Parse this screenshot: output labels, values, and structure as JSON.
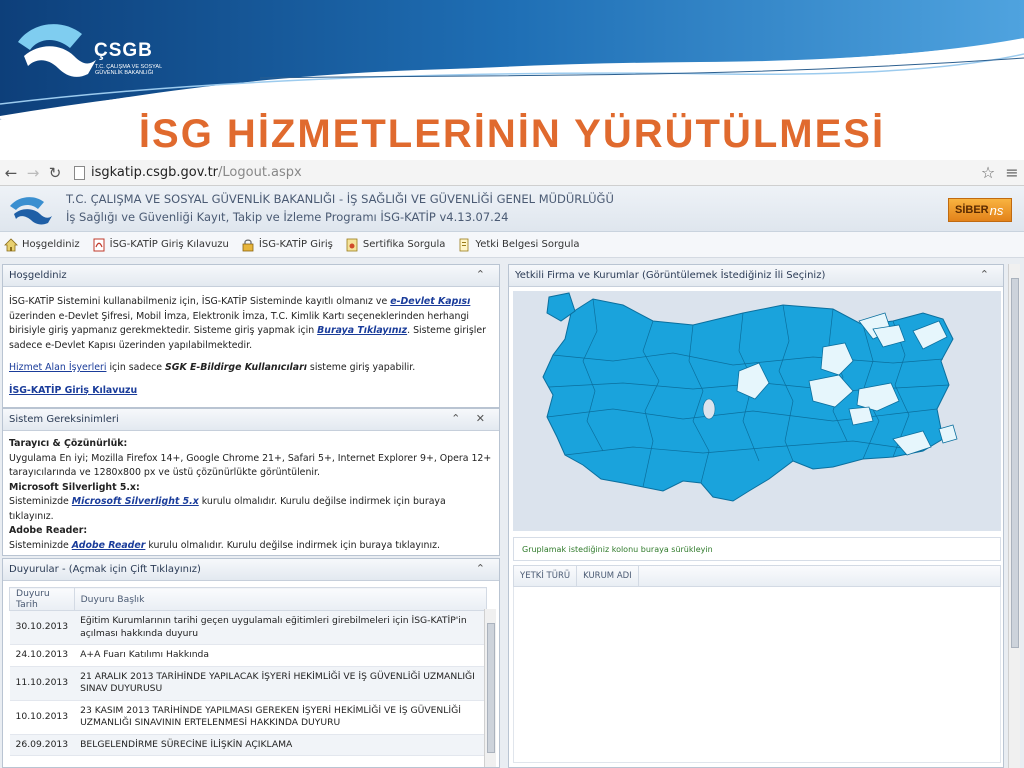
{
  "slide": {
    "logo_text": "ÇSGB",
    "logo_subtitle": "T.C. ÇALIŞMA VE SOSYAL GÜVENLİK BAKANLIĞI",
    "title": "İSG HİZMETLERİNİN YÜRÜTÜLMESİ",
    "colors": {
      "title": "#e06a2e",
      "banner": "#1a5a9e"
    }
  },
  "browser": {
    "url_host": "isgkatip.csgb.gov.tr",
    "url_path": "/Logout.aspx",
    "icons": [
      "back-arrow-icon",
      "forward-arrow-icon",
      "reload-icon",
      "page-icon",
      "star-icon",
      "menu-icon"
    ]
  },
  "app": {
    "title_line1": "T.C. ÇALIŞMA VE SOSYAL GÜVENLİK BAKANLIĞI - İŞ SAĞLIĞI VE GÜVENLİĞİ GENEL MÜDÜRLÜĞÜ",
    "title_line2": "İş Sağlığı ve Güvenliği Kayıt, Takip ve İzleme Programı İSG-KATİP v4.13.07.24",
    "vendor_logo_a": "SİBER",
    "vendor_logo_b": "ns"
  },
  "toolbar": {
    "items": [
      {
        "label": "Hoşgeldiniz",
        "icon": "home-icon"
      },
      {
        "label": "İSG-KATİP Giriş Kılavuzu",
        "icon": "pdf-icon"
      },
      {
        "label": "İSG-KATİP Giriş",
        "icon": "lock-icon"
      },
      {
        "label": "Sertifika Sorgula",
        "icon": "certificate-icon"
      },
      {
        "label": "Yetki Belgesi Sorgula",
        "icon": "document-icon"
      }
    ]
  },
  "welcome": {
    "header": "Hoşgeldiniz",
    "p1_a": "İSG-KATİP Sistemini kullanabilmeniz için, İSG-KATİP Sisteminde kayıtlı olmanız ve ",
    "p1_link": "e-Devlet Kapısı",
    "p1_b": " üzerinden e-Devlet Şifresi, Mobil İmza, Elektronik İmza, T.C. Kimlik Kartı seçeneklerinden herhangi birisiyle giriş yapmanız gerekmektedir. Sisteme giriş yapmak için ",
    "p1_link2": "Buraya Tıklayınız",
    "p1_c": ". Sisteme girişler sadece e-Devlet Kapısı üzerinden yapılabilmektedir.",
    "p2_link": "Hizmet Alan İşyerleri",
    "p2_a": " için sadece ",
    "p2_bold": "SGK E-Bildirge Kullanıcıları",
    "p2_b": " sisteme giriş yapabilir.",
    "guide_link": "İSG-KATİP Giriş Kılavuzu"
  },
  "requirements": {
    "header": "Sistem Gereksinimleri",
    "h1": "Tarayıcı & Çözünürlük:",
    "t1": "Uygulama En iyi; Mozilla Firefox 14+, Google Chrome 21+, Safari 5+, Internet Explorer 9+, Opera 12+ tarayıcılarında ve 1280x800 px ve üstü çözünürlükte görüntülenir.",
    "h2": "Microsoft Silverlight 5.x:",
    "t2_a": "Sisteminizde ",
    "t2_link": "Microsoft Silverlight 5.x",
    "t2_b": " kurulu olmalıdır. Kurulu değilse indirmek için buraya tıklayınız.",
    "h3": "Adobe Reader:",
    "t3_a": "Sisteminizde ",
    "t3_link": "Adobe Reader",
    "t3_b": " kurulu olmalıdır. Kurulu değilse indirmek için buraya tıklayınız."
  },
  "announcements": {
    "header": "Duyurular - (Açmak için Çift Tıklayınız)",
    "col_date": "Duyuru Tarih",
    "col_title": "Duyuru Başlık",
    "rows": [
      {
        "date": "30.10.2013",
        "title": "Eğitim Kurumlarının tarihi geçen uygulamalı eğitimleri girebilmeleri için İSG-KATİP'in açılması hakkında duyuru"
      },
      {
        "date": "24.10.2013",
        "title": "A+A Fuarı Katılımı Hakkında"
      },
      {
        "date": "11.10.2013",
        "title": "21 ARALIK 2013 TARİHİNDE YAPILACAK İŞYERİ HEKİMLİĞİ VE İŞ GÜVENLİĞİ UZMANLIĞI SINAV DUYURUSU"
      },
      {
        "date": "10.10.2013",
        "title": "23 KASIM 2013 TARİHİNDE YAPILMASI GEREKEN İŞYERİ HEKİMLİĞİ VE İŞ GÜVENLİĞİ UZMANLIĞI SINAVININ ERTELENMESİ HAKKINDA DUYURU"
      },
      {
        "date": "26.09.2013",
        "title": "BELGELENDİRME SÜRECİNE İLİŞKİN AÇIKLAMA"
      }
    ]
  },
  "map_panel": {
    "header": "Yetkili Firma ve Kurumlar (Görüntülemek İstediğiniz İli Seçiniz)",
    "group_hint": "Gruplamak istediğiniz kolonu buraya sürükleyin",
    "col_1": "YETKİ TÜRÜ",
    "col_2": "KURUM ADI",
    "colors": {
      "province": "#1aa3dc",
      "province_light": "#e6f6fc",
      "border": "#0b6f9e"
    }
  }
}
